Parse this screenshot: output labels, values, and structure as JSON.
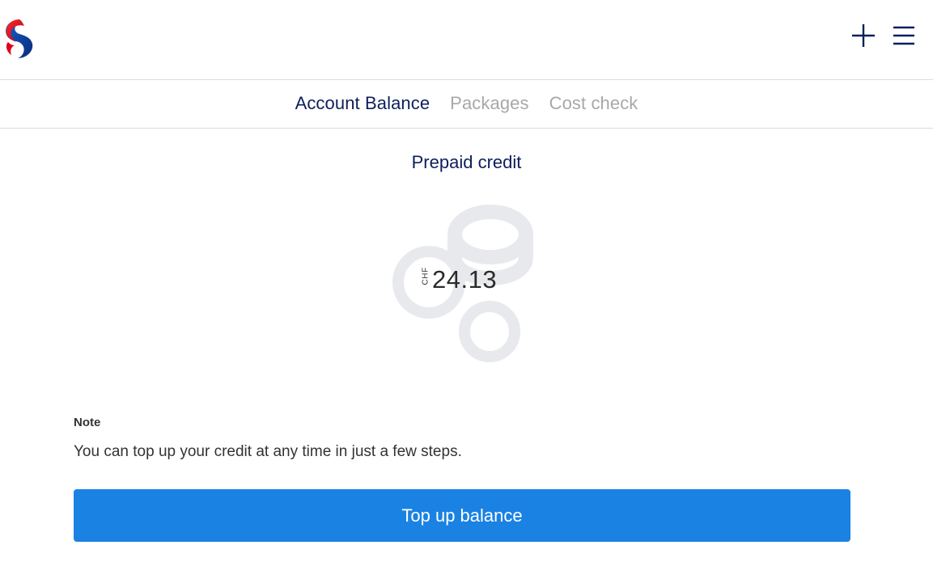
{
  "header": {
    "logo_icon": "swisscom-logo-icon",
    "actions": [
      {
        "icon": "plus-icon"
      },
      {
        "icon": "hamburger-menu-icon"
      }
    ]
  },
  "tabs": [
    {
      "label": "Account Balance",
      "active": true
    },
    {
      "label": "Packages",
      "active": false
    },
    {
      "label": "Cost check",
      "active": false
    }
  ],
  "credit": {
    "title": "Prepaid credit",
    "currency": "CHF",
    "amount": "24.13",
    "illustration_icon": "coins-icon"
  },
  "note": {
    "label": "Note",
    "text": "You can top up your credit at any time in just a few steps."
  },
  "topup_button": {
    "label": "Top up balance"
  },
  "colors": {
    "primary": "#1a82e2",
    "navy": "#0d1f5c",
    "muted": "#a8a8a8",
    "coin": "#e8e9ed"
  }
}
